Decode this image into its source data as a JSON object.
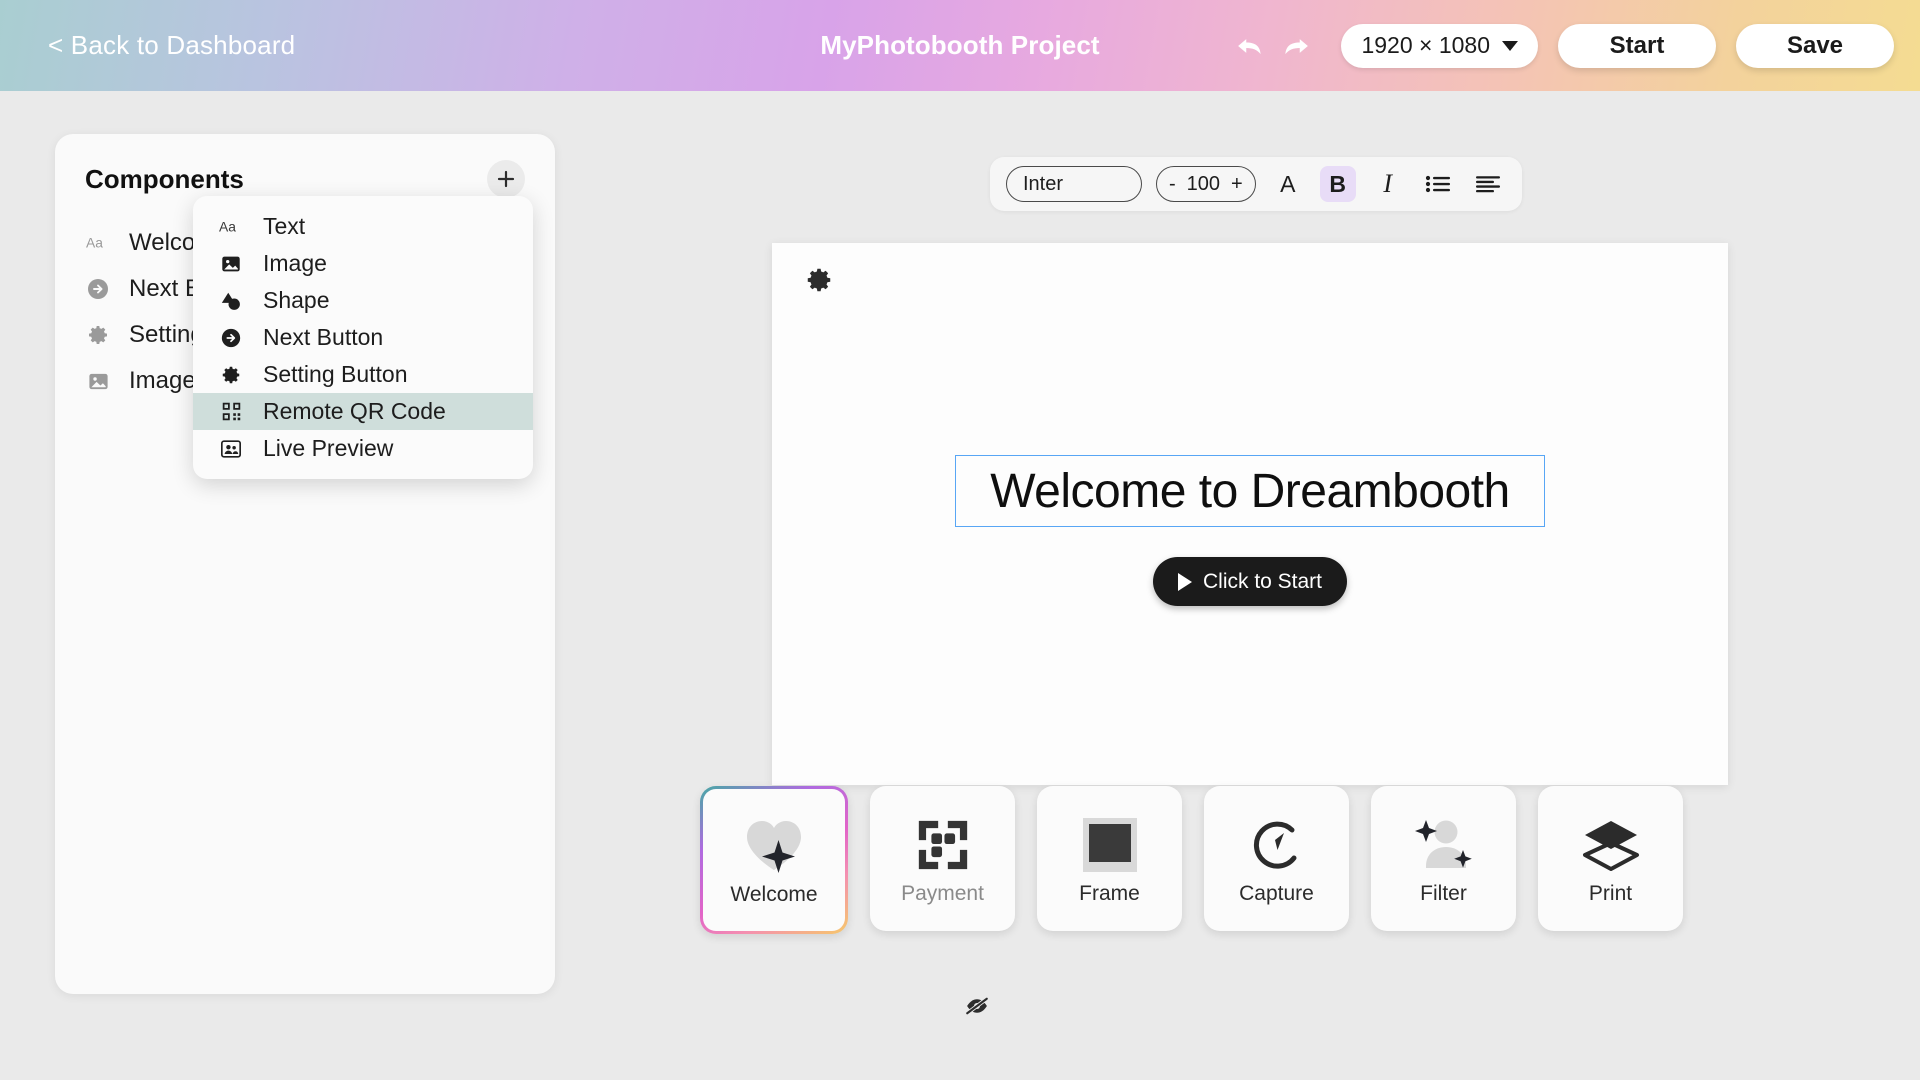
{
  "header": {
    "back_label": "< Back to Dashboard",
    "project_title": "MyPhotobooth Project",
    "undo_icon": "undo-arrow-icon",
    "redo_icon": "redo-arrow-icon",
    "canvas_size": "1920 × 1080",
    "start_label": "Start",
    "save_label": "Save",
    "gradient_start": "#a9ced1",
    "gradient_mid": "#d8a3e9",
    "gradient_end": "#f4dc92"
  },
  "components_panel": {
    "title": "Components",
    "add_icon": "plus-icon",
    "items": [
      {
        "label": "Welcome Text",
        "icon": "text-aa-icon"
      },
      {
        "label": "Next Button",
        "icon": "arrow-circle-right-icon"
      },
      {
        "label": "Setting Button",
        "icon": "gear-icon"
      },
      {
        "label": "Image",
        "icon": "image-icon"
      }
    ]
  },
  "add_menu": {
    "highlighted": "Remote QR Code",
    "items": [
      {
        "label": "Text",
        "icon": "text-aa-icon",
        "active": false
      },
      {
        "label": "Image",
        "icon": "image-icon",
        "active": false
      },
      {
        "label": "Shape",
        "icon": "shape-icon",
        "active": false
      },
      {
        "label": "Next Button",
        "icon": "arrow-circle-right-icon",
        "active": false
      },
      {
        "label": "Setting Button",
        "icon": "gear-icon",
        "active": false
      },
      {
        "label": "Remote QR Code",
        "icon": "qr-code-icon",
        "active": true
      },
      {
        "label": "Live Preview",
        "icon": "people-icon",
        "active": false
      }
    ]
  },
  "text_toolbar": {
    "font_family": "Inter",
    "font_family_placeholder": "Inter",
    "decrease_label": "-",
    "font_size": "100",
    "increase_label": "+",
    "text_color_label": "A",
    "bold_label": "B",
    "italic_label": "I",
    "list_icon": "bulleted-list-icon",
    "align_icon": "align-left-icon",
    "bold_active": true,
    "bold_active_color": "#e8dcf7"
  },
  "canvas": {
    "settings_icon": "gear-icon",
    "welcome_text": "Welcome to Dreambooth",
    "selection_color": "#58a6f5",
    "start_button_label": "Click to Start",
    "play_icon": "play-triangle-icon"
  },
  "screens": {
    "hidden_icon": "eye-slash-icon",
    "items": [
      {
        "label": "Welcome",
        "icon": "heart-sparkle-icon",
        "selected": true,
        "hidden": false
      },
      {
        "label": "Payment",
        "icon": "qr-code-icon",
        "selected": false,
        "hidden": true
      },
      {
        "label": "Frame",
        "icon": "frame-icon",
        "selected": false,
        "hidden": false
      },
      {
        "label": "Capture",
        "icon": "camera-timer-icon",
        "selected": false,
        "hidden": false
      },
      {
        "label": "Filter",
        "icon": "person-sparkle-icon",
        "selected": false,
        "hidden": false
      },
      {
        "label": "Print",
        "icon": "layers-print-icon",
        "selected": false,
        "hidden": false
      }
    ]
  }
}
